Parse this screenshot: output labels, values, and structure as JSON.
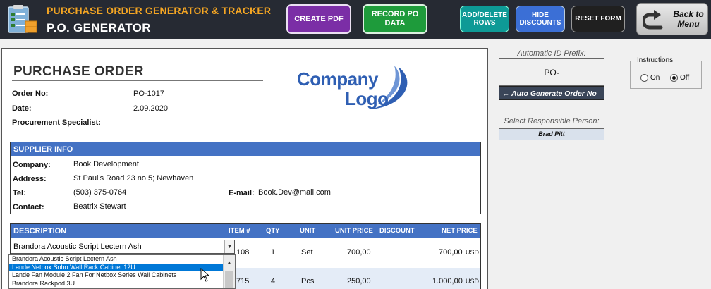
{
  "header": {
    "subtitle": "PURCHASE ORDER GENERATOR & TRACKER",
    "title": "P.O. GENERATOR",
    "buttons": {
      "create_pdf": "CREATE PDF",
      "record_po": "RECORD PO DATA",
      "add_delete": "ADD/DELETE ROWS",
      "hide_discounts": "HIDE DISCOUNTS",
      "reset_form": "RESET FORM",
      "back": "Back to Menu"
    }
  },
  "form": {
    "title": "PURCHASE ORDER",
    "order_no_label": "Order No:",
    "order_no": "PO-1017",
    "date_label": "Date:",
    "date": "2.09.2020",
    "specialist_label": "Procurement Specialist:",
    "logo_line1": "Company",
    "logo_line2": "Logo",
    "supplier": {
      "heading": "SUPPLIER INFO",
      "company_label": "Company:",
      "company": "Book Development",
      "address_label": "Address:",
      "address": "St Paul's Road 23 no 5; Newhaven",
      "tel_label": "Tel:",
      "tel": "(503) 375-0764",
      "email_label": "E-mail:",
      "email": "Book.Dev@mail.com",
      "contact_label": "Contact:",
      "contact": "Beatrix Stewart"
    },
    "items": {
      "headers": {
        "description": "DESCRIPTION",
        "item": "ITEM #",
        "qty": "QTY",
        "unit": "UNIT",
        "unit_price": "UNIT PRICE",
        "discount": "DISCOUNT",
        "net_price": "NET PRICE"
      },
      "rows": [
        {
          "description": "Brandora Acoustic Script Lectern Ash",
          "item_partial": "108",
          "qty": "1",
          "unit": "Set",
          "unit_price": "700,00",
          "net_price": "700,00",
          "currency": "USD"
        },
        {
          "item_partial": "715",
          "qty": "4",
          "unit": "Pcs",
          "unit_price": "250,00",
          "net_price": "1.000,00",
          "currency": "USD"
        }
      ],
      "dropdown_options": [
        "Brandora Acoustic Script Lectern Ash",
        "Lande Netbox Soho Wall Rack Cabinet 12U",
        "Lande Fan Module 2 Fan For Netbox Series Wall Cabinets",
        "Brandora Rackpod 3U"
      ],
      "dropdown_selected_index": 1
    }
  },
  "right": {
    "prefix_caption": "Automatic ID Prefix:",
    "prefix_value": "PO-",
    "autogen_label": "Auto Generate Order No",
    "person_caption": "Select Responsible Person:",
    "person_value": "Brad Pitt",
    "instructions_title": "Instructions",
    "on_label": "On",
    "off_label": "Off",
    "selected": "Off"
  },
  "colors": {
    "header_bg": "#262a33",
    "accent_orange": "#f5a623",
    "section_blue": "#4472c4",
    "pdf_purple": "#7b2ea6",
    "record_green": "#1e9b3b"
  }
}
